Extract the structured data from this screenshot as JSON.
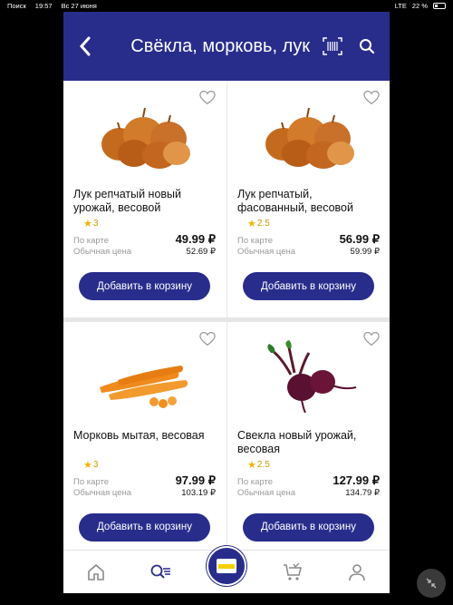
{
  "status_bar": {
    "carrier": "Поиск",
    "time": "19:57",
    "date": "Вс 27 июня",
    "network": "LTE",
    "battery": "22 %"
  },
  "header": {
    "title": "Свёкла, морковь, лук",
    "back_icon": "chevron-left-icon",
    "barcode_icon": "barcode-scan-icon",
    "search_icon": "search-icon"
  },
  "labels": {
    "card_price": "По карте",
    "regular_price": "Обычная цена",
    "add_to_cart": "Добавить в корзину"
  },
  "products": [
    {
      "name": "Лук репчатый новый урожай, весовой",
      "rating": "3",
      "card_price": "49.99 ₽",
      "regular_price": "52.69 ₽",
      "image": "onions"
    },
    {
      "name": "Лук репчатый, фасованный, весовой",
      "rating": "2.5",
      "card_price": "56.99 ₽",
      "regular_price": "59.99 ₽",
      "image": "onions"
    },
    {
      "name": "Морковь мытая, весовая",
      "rating": "3",
      "card_price": "97.99 ₽",
      "regular_price": "103.19 ₽",
      "image": "carrots"
    },
    {
      "name": "Свекла новый урожай, весовая",
      "rating": "2.5",
      "card_price": "127.99 ₽",
      "regular_price": "134.79 ₽",
      "image": "beets"
    }
  ],
  "navbar": {
    "items": [
      "home-icon",
      "catalog-search-icon",
      "loyalty-card-icon",
      "cart-icon",
      "profile-icon"
    ]
  },
  "colors": {
    "brand": "#282d8c",
    "star": "#f5b400"
  }
}
